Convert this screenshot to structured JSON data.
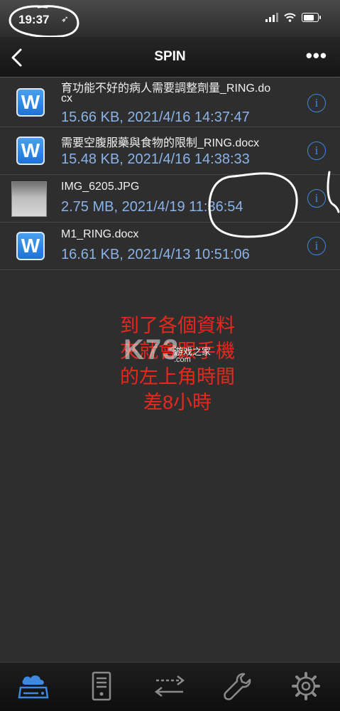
{
  "status": {
    "time": "19:37",
    "location_arrow": "➶"
  },
  "nav": {
    "title": "SPIN",
    "more": "•••"
  },
  "files": [
    {
      "name_line1": "育功能不好的病人需要調整劑量_RING.do",
      "name_line2": "cx",
      "meta": "15.66 KB, 2021/4/16 14:37:47",
      "icon": "word-doc-icon"
    },
    {
      "name_line1": "需要空腹服藥與食物的限制_RING.docx",
      "meta": "15.48 KB, 2021/4/16 14:38:33",
      "icon": "word-doc-icon"
    },
    {
      "name_line1": "IMG_6205.JPG",
      "meta": "2.75 MB, 2021/4/19 11:36:54",
      "icon": "image-thumbnail"
    },
    {
      "name_line1": "M1_RING.docx",
      "meta": "16.61 KB, 2021/4/13 10:51:06",
      "icon": "word-doc-icon"
    }
  ],
  "word_icon_letter": "W",
  "info_glyph": "i",
  "annotation_lines": [
    "到了各個資料",
    "夾就會跟手機",
    "的左上角時間",
    "差8小時"
  ],
  "watermark": {
    "logo": "K73",
    "text": "游戏之家",
    "sub": ".com"
  },
  "tabs": [
    "cloud-storage-icon",
    "server-icon",
    "transfer-icon",
    "wrench-icon",
    "gear-icon"
  ],
  "colors": {
    "accent": "#3d88e0",
    "meta_text": "#8ab3e8",
    "annotation": "#e8281e"
  }
}
